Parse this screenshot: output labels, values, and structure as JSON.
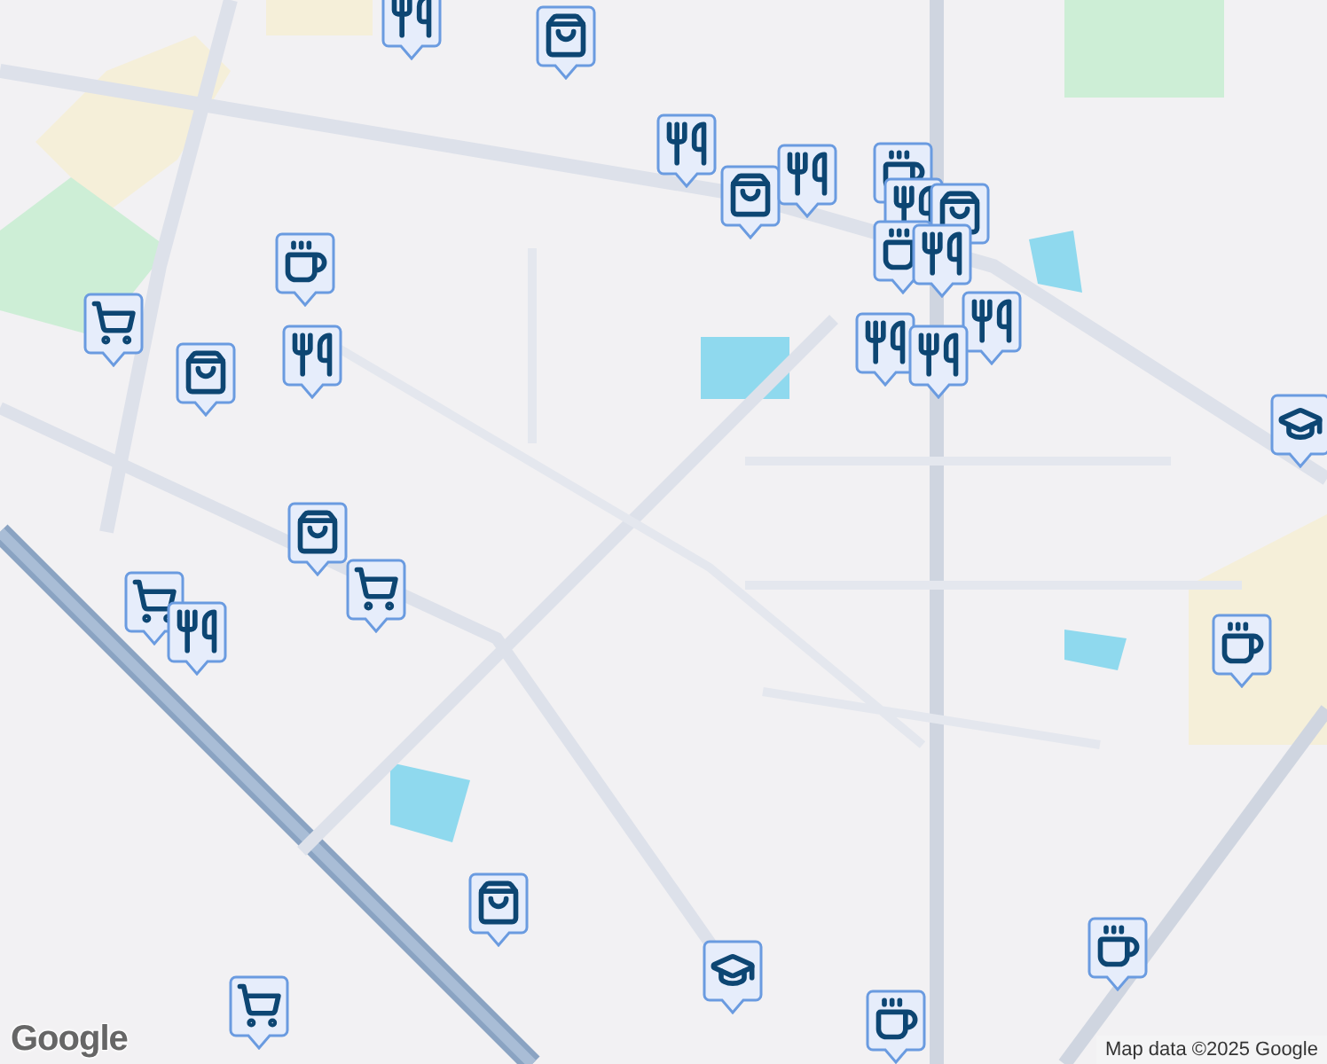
{
  "markers": [
    {
      "kind": "restaurant"
    },
    {
      "kind": "shop"
    },
    {
      "kind": "restaurant"
    },
    {
      "kind": "shop"
    },
    {
      "kind": "restaurant"
    },
    {
      "kind": "cafe"
    },
    {
      "kind": "restaurant"
    },
    {
      "kind": "shop"
    },
    {
      "kind": "cafe"
    },
    {
      "kind": "restaurant"
    },
    {
      "kind": "restaurant"
    },
    {
      "kind": "restaurant"
    },
    {
      "kind": "restaurant"
    },
    {
      "kind": "cafe"
    },
    {
      "kind": "restaurant"
    },
    {
      "kind": "grocery"
    },
    {
      "kind": "shop"
    },
    {
      "kind": "school"
    },
    {
      "kind": "shop"
    },
    {
      "kind": "grocery"
    },
    {
      "kind": "grocery"
    },
    {
      "kind": "restaurant"
    },
    {
      "kind": "cafe"
    },
    {
      "kind": "shop"
    },
    {
      "kind": "school"
    },
    {
      "kind": "cafe"
    },
    {
      "kind": "grocery"
    },
    {
      "kind": "cafe"
    }
  ],
  "attribution": {
    "logo": "Google",
    "text": "Map data ©2025 Google"
  }
}
